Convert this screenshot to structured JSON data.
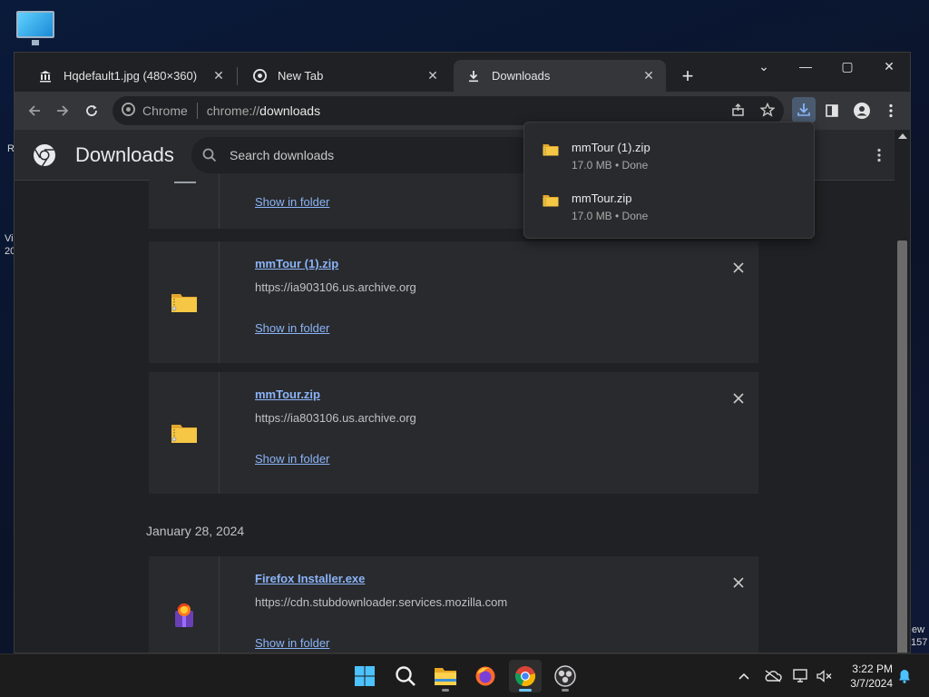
{
  "desktop": {
    "left_fragments": [
      "R",
      "Vi",
      "20"
    ],
    "right_fragments": [
      "ew",
      "157"
    ]
  },
  "tabs": [
    {
      "title": "Hqdefault1.jpg (480×360)",
      "icon": "museum-icon",
      "active": false
    },
    {
      "title": "New Tab",
      "icon": "chrome-icon",
      "active": false
    },
    {
      "title": "Downloads",
      "icon": "download-icon",
      "active": true
    }
  ],
  "window_controls": {
    "tab_search": "⌄",
    "minimize": "—",
    "maximize": "▢",
    "close": "✕"
  },
  "omnibox": {
    "chip_label": "Chrome",
    "url_scheme": "chrome://",
    "url_host": "downloads"
  },
  "downloads_page": {
    "title": "Downloads",
    "search_placeholder": "Search downloads",
    "partial_item": {
      "show_in_folder": "Show in folder"
    },
    "items": [
      {
        "name": "mmTour (1).zip",
        "url": "https://ia903106.us.archive.org",
        "show_in_folder": "Show in folder",
        "icon": "zip-folder-icon"
      },
      {
        "name": "mmTour.zip",
        "url": "https://ia803106.us.archive.org",
        "show_in_folder": "Show in folder",
        "icon": "zip-folder-icon"
      }
    ],
    "date_group": "January 28, 2024",
    "older_items": [
      {
        "name": "Firefox Installer.exe",
        "url": "https://cdn.stubdownloader.services.mozilla.com",
        "show_in_folder": "Show in folder",
        "icon": "firefox-installer-icon"
      }
    ]
  },
  "downloads_bubble": {
    "items": [
      {
        "name": "mmTour (1).zip",
        "meta": "17.0 MB • Done"
      },
      {
        "name": "mmTour.zip",
        "meta": "17.0 MB • Done"
      }
    ]
  },
  "taskbar": {
    "apps": [
      "windows-start-icon",
      "search-icon",
      "file-explorer-icon",
      "firefox-icon",
      "chrome-icon",
      "obs-icon"
    ],
    "clock_time": "3:22 PM",
    "clock_date": "3/7/2024"
  },
  "colors": {
    "accent_link": "#8ab4f8",
    "folder_yellow": "#f6c744"
  }
}
